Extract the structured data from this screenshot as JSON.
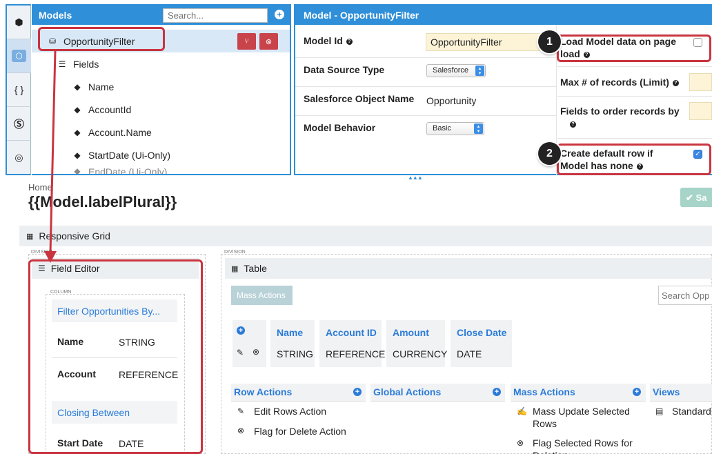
{
  "sidebar_tools": [
    {
      "icon": "cube-icon"
    },
    {
      "icon": "model-cube-icon"
    },
    {
      "icon": "braces-icon",
      "label": "{ }"
    },
    {
      "icon": "css3-icon"
    },
    {
      "icon": "globe-icon"
    }
  ],
  "models_panel": {
    "title": "Models",
    "search_placeholder": "Search...",
    "tree": [
      {
        "label": "OpportunityFilter",
        "icon": "database-icon",
        "selected": true
      },
      {
        "label": "Fields",
        "icon": "list-icon"
      },
      {
        "label": "Name",
        "icon": "tag-icon"
      },
      {
        "label": "AccountId",
        "icon": "tag-icon"
      },
      {
        "label": "Account.Name",
        "icon": "tag-icon"
      },
      {
        "label": "StartDate (Ui-Only)",
        "icon": "tag-icon"
      },
      {
        "label": "EndDate (Ui-Only)",
        "icon": "tag-icon"
      }
    ]
  },
  "model_props": {
    "title": "Model - OpportunityFilter",
    "model_id_label": "Model Id",
    "model_id_value": "OpportunityFilter",
    "data_source_label": "Data Source Type",
    "data_source_value": "Salesforce",
    "sobject_label": "Salesforce Object Name",
    "sobject_value": "Opportunity",
    "behavior_label": "Model Behavior",
    "behavior_value": "Basic",
    "load_data_label": "Load Model data on page load",
    "load_data_checked": false,
    "max_records_label": "Max # of records (Limit)",
    "order_fields_label": "Fields to order records by",
    "default_row_label": "Create default row if Model has none",
    "default_row_checked": true,
    "callouts": [
      "1",
      "2"
    ]
  },
  "page": {
    "breadcrumb": "Home",
    "title": "{{Model.labelPlural}}",
    "save_label": "Sa",
    "grid_label": "Responsive Grid",
    "division_label": "DIVISION",
    "column_label": "COLUMN",
    "field_editor_label": "Field Editor",
    "field_editor": {
      "section1": "Filter Opportunities By...",
      "rows1": [
        {
          "name": "Name",
          "type": "STRING"
        },
        {
          "name": "Account",
          "type": "REFERENCE"
        }
      ],
      "section2": "Closing Between",
      "rows2": [
        {
          "name": "Start Date",
          "type": "DATE"
        }
      ]
    },
    "table_label": "Table",
    "mass_actions_button": "Mass Actions",
    "search_placeholder": "Search Opp",
    "columns": [
      {
        "name": "Name",
        "type": "STRING"
      },
      {
        "name": "Account ID",
        "type": "REFERENCE"
      },
      {
        "name": "Amount",
        "type": "CURRENCY"
      },
      {
        "name": "Close Date",
        "type": "DATE"
      }
    ],
    "row_actions": {
      "title": "Row Actions",
      "items": [
        "Edit Rows Action",
        "Flag for Delete Action"
      ]
    },
    "global_actions": {
      "title": "Global Actions"
    },
    "mass_actions": {
      "title": "Mass Actions",
      "items": [
        "Mass Update Selected Rows",
        "Flag Selected Rows for Deletion"
      ]
    },
    "views": {
      "title": "Views",
      "items": [
        "Standard"
      ]
    }
  },
  "colors": {
    "accent": "#2f8fd8",
    "callout_red": "#c9343f",
    "link": "#2b7bd8"
  }
}
